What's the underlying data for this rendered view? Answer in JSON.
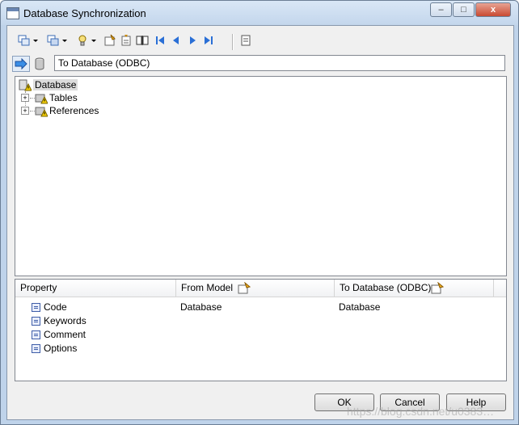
{
  "window": {
    "title": "Database Synchronization",
    "controls": {
      "minimize": "–",
      "maximize": "□",
      "close": "x"
    }
  },
  "toolbar": {
    "icons": [
      "expand-all-icon",
      "collapse-icon",
      "filter-icon",
      "properties-icon",
      "find-icon",
      "compare-icon",
      "first-icon",
      "previous-icon",
      "next-icon",
      "last-icon",
      "report-icon"
    ]
  },
  "target": {
    "label": "To Database (ODBC)"
  },
  "tree": {
    "root": "Database",
    "children": [
      {
        "label": "Tables"
      },
      {
        "label": "References"
      }
    ]
  },
  "grid": {
    "headers": [
      "Property",
      "From Model",
      "To Database (ODBC)"
    ],
    "rows": [
      {
        "property": "Code",
        "from_model": "Database",
        "to_database": "Database"
      },
      {
        "property": "Keywords",
        "from_model": "",
        "to_database": ""
      },
      {
        "property": "Comment",
        "from_model": "",
        "to_database": ""
      },
      {
        "property": "Options",
        "from_model": "",
        "to_database": ""
      }
    ]
  },
  "buttons": {
    "ok": "OK",
    "cancel": "Cancel",
    "help": "Help"
  },
  "watermark": "https://blog.csdn.net/u0383…",
  "colors": {
    "warning": "#f5d000",
    "nav_blue": "#2a6fd6",
    "titlebar": "#c3d6ec"
  }
}
